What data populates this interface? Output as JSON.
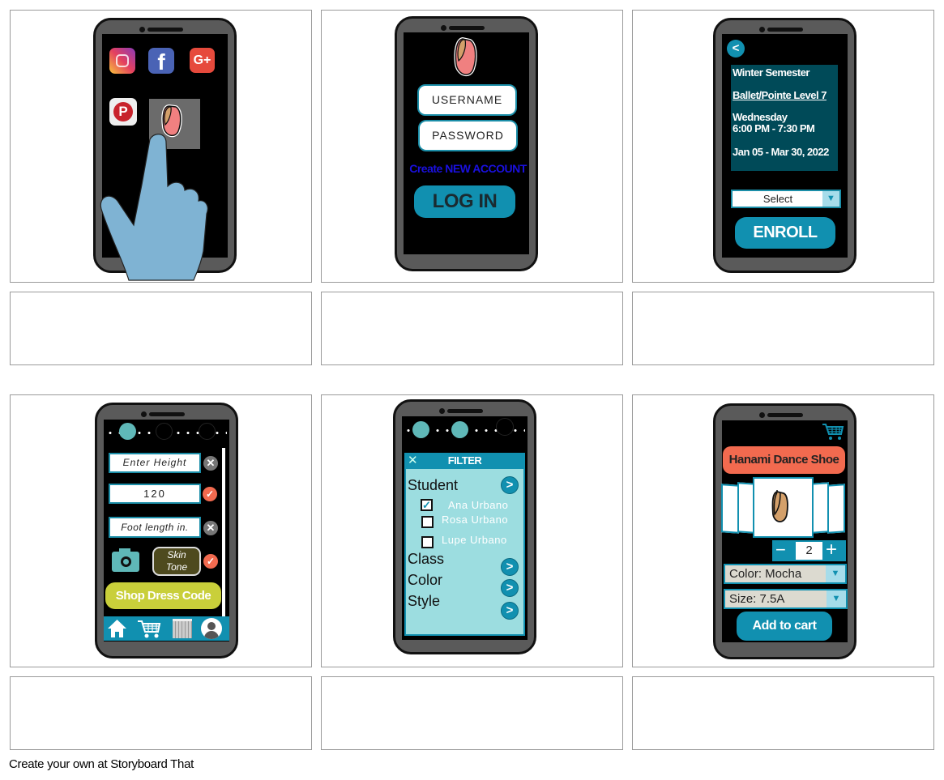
{
  "footer": "Create your own at Storyboard That",
  "colors": {
    "accent": "#1190b0",
    "coral": "#f26a4f",
    "lime": "#c9cf3a",
    "panel": "#004a58",
    "filter_bg": "#9cdde0"
  },
  "panel1": {
    "icons": [
      "instagram-icon",
      "facebook-icon",
      "google-plus-icon",
      "pinterest-icon",
      "app-shoe-icon",
      "hand-pointer-icon"
    ]
  },
  "panel2": {
    "username_placeholder": "USERNAME",
    "password_placeholder": "PASSWORD",
    "create_account": "Create NEW ACCOUNT",
    "login": "LOG IN"
  },
  "panel3": {
    "semester": "Winter Semester",
    "class": "Ballet/Pointe Level 7",
    "day": "Wednesday",
    "time": "6:00 PM - 7:30 PM",
    "dates": "Jan 05 - Mar 30, 2022",
    "select": "Select",
    "enroll": "ENROLL"
  },
  "panel4": {
    "height_placeholder": "Enter Height",
    "height_value": "120",
    "foot_placeholder": "Foot length in.",
    "skin_tone_line1": "Skin",
    "skin_tone_line2": "Tone",
    "shop": "Shop Dress Code",
    "nav": [
      "home-icon",
      "cart-icon",
      "calendar-icon",
      "profile-icon"
    ]
  },
  "panel5": {
    "title": "FILTER",
    "student": "Student",
    "students": [
      {
        "name": "Ana Urbano",
        "checked": true
      },
      {
        "name": "Rosa Urbano",
        "checked": false
      },
      {
        "name": "Lupe Urbano",
        "checked": false
      }
    ],
    "class": "Class",
    "color": "Color",
    "style": "Style"
  },
  "panel6": {
    "product": "Hanami Dance Shoe",
    "quantity": "2",
    "minus": "−",
    "plus": "+",
    "color": "Color: Mocha",
    "size": "Size: 7.5A",
    "add": "Add to cart"
  }
}
